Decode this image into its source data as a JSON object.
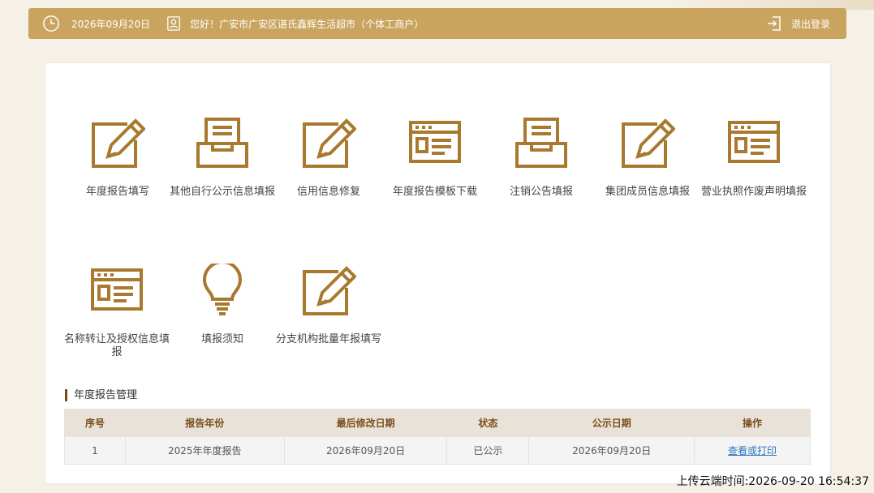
{
  "header": {
    "date": "2026年09月20日",
    "greeting": "您好！广安市广安区谌氏鑫辉生活超市（个体工商户）",
    "logout_label": "退出登录",
    "bar_color": "#c9a45f"
  },
  "tiles": [
    {
      "label": "年度报告填写",
      "icon": "edit-icon"
    },
    {
      "label": "其他自行公示信息填报",
      "icon": "inbox-tray-icon"
    },
    {
      "label": "信用信息修复",
      "icon": "edit-icon"
    },
    {
      "label": "年度报告模板下载",
      "icon": "window-form-icon"
    },
    {
      "label": "注销公告填报",
      "icon": "inbox-tray-icon"
    },
    {
      "label": "集团成员信息填报",
      "icon": "edit-icon"
    },
    {
      "label": "营业执照作废声明填报",
      "icon": "window-form-icon"
    },
    {
      "label": "名称转让及授权信息填报",
      "icon": "window-form-icon"
    },
    {
      "label": "填报须知",
      "icon": "lightbulb-icon"
    },
    {
      "label": "分支机构批量年报填写",
      "icon": "edit-icon"
    }
  ],
  "report_section": {
    "title": "年度报告管理",
    "columns": [
      "序号",
      "报告年份",
      "最后修改日期",
      "状态",
      "公示日期",
      "操作"
    ],
    "rows": [
      {
        "index": "1",
        "year": "2025年年度报告",
        "modified": "2026年09月20日",
        "status": "已公示",
        "published": "2026年09月20日",
        "action": "查看或打印"
      }
    ]
  },
  "upload_time": "上传云端时间:2026-09-20 16:54:37",
  "colors": {
    "icon": "#a8792e",
    "accent": "#7a4a1d"
  }
}
